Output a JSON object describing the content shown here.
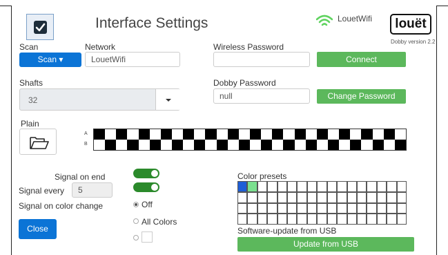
{
  "header": {
    "title": "Interface Settings",
    "wifi_name": "LouetWifi",
    "logo_text": "louët",
    "version": "Dobby version 2.2"
  },
  "network": {
    "scan_label": "Scan",
    "scan_button": "Scan ▾",
    "network_label": "Network",
    "network_value": "LouetWifi",
    "wireless_password_label": "Wireless Password",
    "wireless_password_value": "",
    "connect_button": "Connect"
  },
  "shafts": {
    "label": "Shafts",
    "value": "32",
    "dobby_password_label": "Dobby Password",
    "dobby_password_value": "null",
    "change_password_button": "Change Password"
  },
  "plain": {
    "label": "Plain",
    "row_a": "A",
    "row_b": "B",
    "columns": 28
  },
  "signals": {
    "signal_on_end_label": "Signal on end",
    "signal_every_label": "Signal every",
    "signal_every_value": "5",
    "signal_on_color_change_label": "Signal on color change",
    "signal_on_end_enabled": true,
    "signal_every_enabled": true,
    "options": [
      {
        "label": "Off",
        "checked": true
      },
      {
        "label": "All Colors",
        "checked": false
      },
      {
        "label": "",
        "checked": false
      }
    ]
  },
  "close_button": "Close",
  "color_presets": {
    "label": "Color presets",
    "rows": 4,
    "cols": 17,
    "filled": [
      {
        "index": 0,
        "color": "#1f5fd6"
      },
      {
        "index": 1,
        "color": "#7be08f"
      }
    ]
  },
  "update": {
    "label": "Software-update from USB",
    "button": "Update from USB"
  },
  "colors": {
    "primary": "#0b74d6",
    "success": "#5cb85c",
    "toggle_on": "#2b8a2b"
  }
}
